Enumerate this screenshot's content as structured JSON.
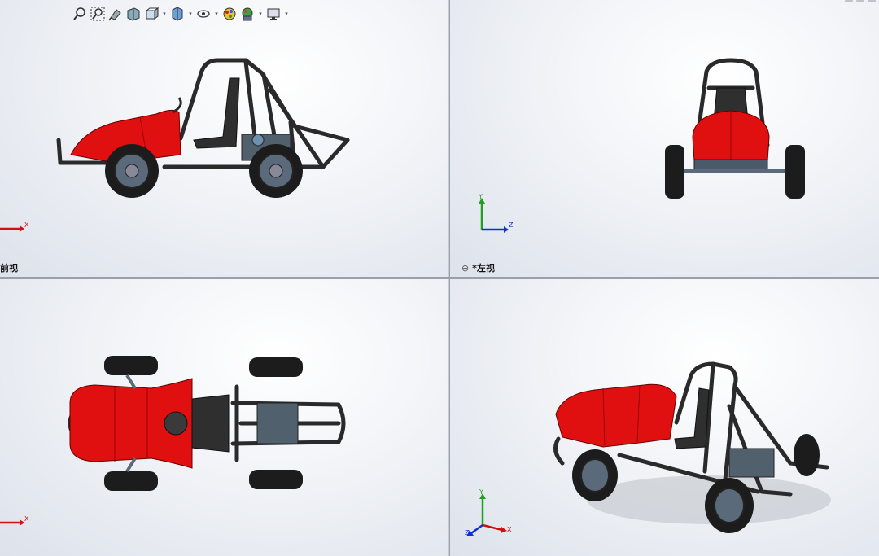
{
  "toolbar": {
    "items": [
      "zoom-to-fit-icon",
      "zoom-to-area-icon",
      "previous-view-icon",
      "section-view-icon",
      "view-orientation-icon",
      "display-style-icon",
      "hide-show-items-icon",
      "edit-appearance-icon",
      "apply-scene-icon",
      "view-settings-icon"
    ]
  },
  "viewports": {
    "front": {
      "label": "前视",
      "axes": {
        "h": "X",
        "v": ""
      }
    },
    "left": {
      "label": "*左视",
      "axes": {
        "h": "Z",
        "v": "Y"
      }
    },
    "top": {
      "label": "",
      "axes": {
        "h": "X",
        "v": ""
      }
    },
    "iso": {
      "label": "",
      "axes": {
        "h": "X",
        "v": "Y",
        "d": "Z"
      }
    }
  },
  "colors": {
    "body_red": "#e01010",
    "tube": "#2a2a2a",
    "tire": "#1c1c1c",
    "rim": "#5a6a7a",
    "axis_x": "#d01010",
    "axis_y": "#20a020",
    "axis_z": "#1030d0"
  }
}
